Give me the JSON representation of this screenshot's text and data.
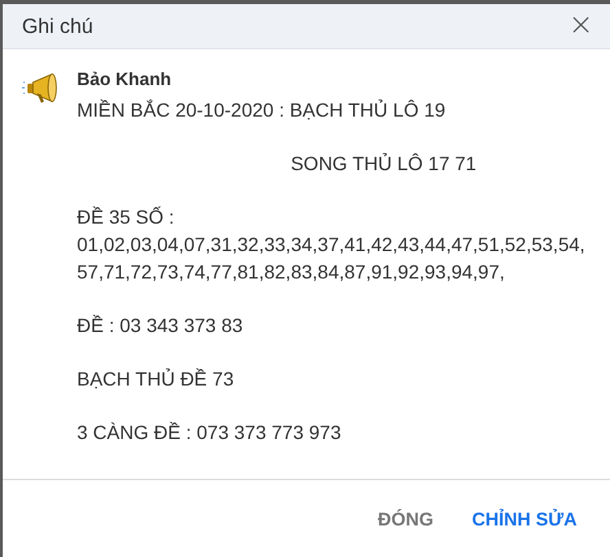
{
  "window": {
    "title": "Ghi chú",
    "close": "×"
  },
  "note": {
    "author": "Bảo Khanh",
    "paragraphs": [
      {
        "lines": [
          "MIỀN BẮC 20-10-2020 : BẠCH THỦ LÔ 19"
        ]
      },
      {
        "lines": [
          "                                        SONG THỦ LÔ 17 71"
        ]
      },
      {
        "lines": [
          "ĐỀ 35 SỐ :",
          "01,02,03,04,07,31,32,33,34,37,41,42,43,44,47,51,52,53,54,",
          "57,71,72,73,74,77,81,82,83,84,87,91,92,93,94,97,"
        ]
      },
      {
        "lines": [
          "ĐỀ : 03 343 373 83"
        ]
      },
      {
        "lines": [
          "BẠCH THỦ ĐỀ 73"
        ]
      },
      {
        "lines": [
          "3 CÀNG ĐỀ : 073 373 773 973"
        ]
      }
    ]
  },
  "buttons": [
    {
      "label": "ĐÓNG",
      "kind": "secondary"
    },
    {
      "label": "CHỈNH SỬA",
      "kind": "primary"
    }
  ]
}
